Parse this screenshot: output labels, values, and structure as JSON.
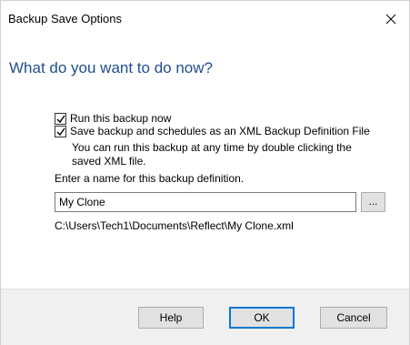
{
  "window": {
    "title": "Backup Save Options",
    "close_icon": "close-icon"
  },
  "main": {
    "heading": "What do you want to do now?",
    "options": [
      {
        "label": "Run this backup now",
        "checked": true
      },
      {
        "label": "Save backup and schedules as an XML Backup Definition File",
        "checked": true
      }
    ],
    "help_text": "You can run this backup at any time by double clicking the saved XML file.",
    "name_prompt": "Enter a name for this backup definition.",
    "name_value": "My Clone",
    "browse_label": "...",
    "file_path": "C:\\Users\\Tech1\\Documents\\Reflect\\My Clone.xml"
  },
  "footer": {
    "help_label": "Help",
    "ok_label": "OK",
    "cancel_label": "Cancel"
  },
  "colors": {
    "heading": "#1f4e8c",
    "footer_bg": "#f0f0f0",
    "default_button_border": "#0078d7"
  }
}
